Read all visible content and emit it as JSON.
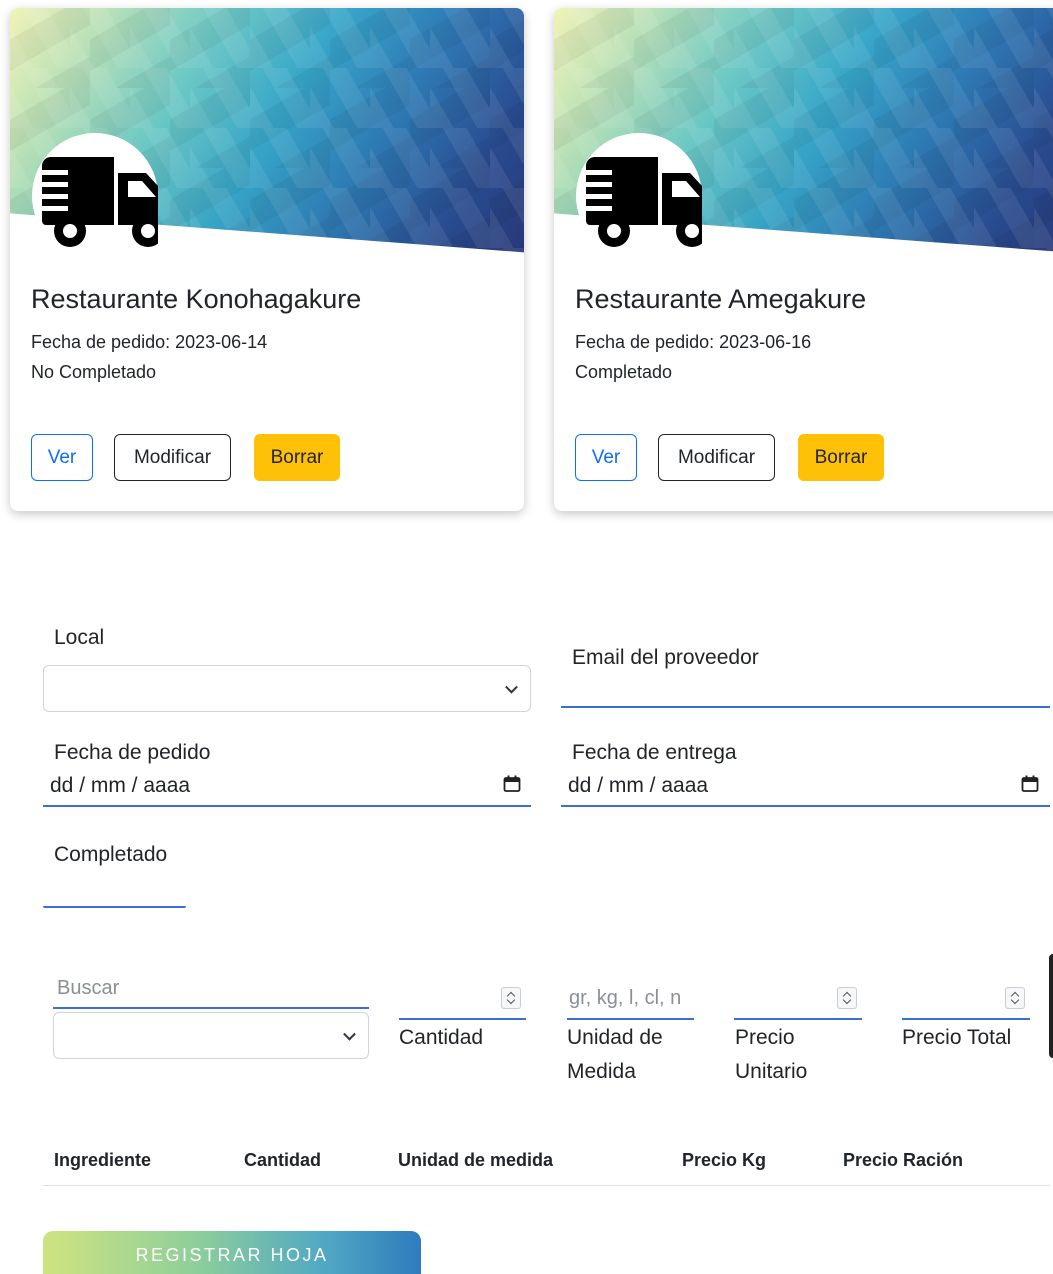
{
  "cards": [
    {
      "title": "Restaurante Konohagakure",
      "date_text": "Fecha de pedido: 2023-06-14",
      "status": "No Completado",
      "buttons": {
        "view": "Ver",
        "edit": "Modificar",
        "delete": "Borrar"
      },
      "icon": "truck-icon"
    },
    {
      "title": "Restaurante Amegakure",
      "date_text": "Fecha de pedido: 2023-06-16",
      "status": "Completado",
      "buttons": {
        "view": "Ver",
        "edit": "Modificar",
        "delete": "Borrar"
      },
      "icon": "truck-icon"
    }
  ],
  "form": {
    "local_label": "Local",
    "local_value": "",
    "email_label": "Email del proveedor",
    "order_date_label": "Fecha de pedido",
    "order_date_value": "dd / mm / aaaa",
    "delivery_date_label": "Fecha de entrega",
    "delivery_date_value": "dd / mm / aaaa",
    "completed_label": "Completado"
  },
  "ingredient_row": {
    "search_placeholder": "Buscar",
    "quantity_label": "Cantidad",
    "unit_placeholder": "gr, kg, l, cl, n",
    "unit_label_line1": "Unidad de",
    "unit_label_line2": "Medida",
    "unit_price_label_line1": "Precio",
    "unit_price_label_line2": "Unitario",
    "total_price_label": "Precio Total"
  },
  "table": {
    "headers": [
      "Ingrediente",
      "Cantidad",
      "Unidad de medida",
      "Precio Kg",
      "Precio Ración"
    ]
  },
  "register_button": "REGISTRAR HOJA",
  "colors": {
    "primary": "#0d6efd",
    "warning": "#ffc107",
    "underline": "#3b6fd6"
  }
}
